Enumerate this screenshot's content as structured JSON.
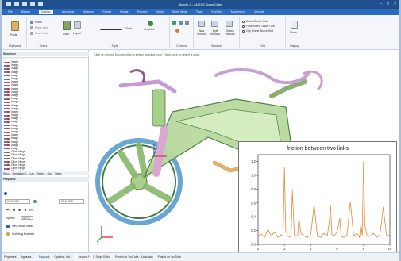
{
  "app": {
    "title": "Bicycle-2 - ANSYS SpaceClaim"
  },
  "menu": {
    "tabs": [
      "File",
      "Design",
      "Display",
      "Assembly",
      "Measure",
      "Facets",
      "Repair",
      "Prepare",
      "Detail",
      "Sheet Metal",
      "Tools",
      "KeyShot",
      "Momentum",
      "Uenzzle"
    ],
    "active_tab": "Display"
  },
  "ribbon": {
    "clipboard": {
      "label": "Clipboard",
      "paste": "Paste"
    },
    "orient": {
      "label": "Orient",
      "home": "Home",
      "plane_view": "Plane View",
      "snap_view": "Snap View"
    },
    "style": {
      "label": "Style",
      "color": "Color",
      "layout": "Layout",
      "thick": "Thick",
      "graphics": "Graphics"
    },
    "camera": {
      "label": "Camera"
    },
    "window": {
      "label": "Window",
      "new_window": "New Window",
      "split_window": "Split Window",
      "switch_window": "Switch Window"
    },
    "grid": {
      "label": "Grid",
      "opt1": "Show Sketch Grid",
      "opt2": "Fade Scene Under Grid",
      "opt3": "Clip Scene Above Grid"
    },
    "display": {
      "label": "Display",
      "show": "Show"
    }
  },
  "structure": {
    "header": "Structure",
    "items": [
      "Image",
      "Image",
      "Image",
      "Image",
      "Image",
      "Image",
      "Image",
      "Image",
      "Image",
      "Image",
      "Image",
      "Image",
      "Image",
      "Image",
      "Image",
      "Image",
      "Image",
      "Image",
      "Image",
      "Image",
      "Image",
      "Image",
      "Image",
      "Image",
      "Image",
      "Image",
      "Image",
      "Other Hinge",
      "Other Hinge",
      "Other Hinge",
      "Other Hinge",
      "Other Hinge",
      "Other Hinge",
      "Other Hinge"
    ],
    "tabs": "Struc… Simulation  S… Lay… Select… Gro… Views"
  },
  "playback": {
    "header": "Playback",
    "time_start": "00:00.000",
    "time_end": "00:40.000",
    "speed_label": "Speed:",
    "speed_value": "100 %",
    "new_initial_state": "New Initial State",
    "scripting": "Scripting Enabled"
  },
  "viewport": {
    "hint": "Click an object. Double-click to select an edge loop. Triple-click to select a solid."
  },
  "status": {
    "items": [
      "Properties",
      "Appeara…",
      "Playback",
      "Options - Sel…",
      "Bicycle-2*",
      "Script Editor",
      "Posted on YouTube - Koalcrash",
      "Posted on YouTube"
    ]
  },
  "chart_data": {
    "type": "line",
    "title": "friction between two links",
    "xlabel": "",
    "ylabel": "",
    "xlim": [
      0,
      10
    ],
    "ylim": [
      0,
      1.3
    ],
    "xticks": [
      0,
      2,
      4,
      6,
      8,
      10
    ],
    "yticks": [
      0.0,
      0.2,
      0.4,
      0.6,
      0.8,
      1.0,
      1.2
    ],
    "grid": false,
    "series": [
      {
        "name": "",
        "color": "#e08a3c",
        "x": [
          0.0,
          0.25,
          0.5,
          0.75,
          1.0,
          1.25,
          1.5,
          1.75,
          1.9,
          2.0,
          2.1,
          2.25,
          2.5,
          2.6,
          2.75,
          3.0,
          3.1,
          3.25,
          3.5,
          3.75,
          4.0,
          4.25,
          4.5,
          4.75,
          5.0,
          5.25,
          5.4,
          5.5,
          5.6,
          5.75,
          6.0,
          6.2,
          6.3,
          6.5,
          6.75,
          7.0,
          7.25,
          7.5,
          7.7,
          7.8,
          7.9,
          8.0,
          8.1,
          8.25,
          8.5,
          8.75,
          9.0,
          9.25,
          9.5,
          9.75,
          10.0
        ],
        "y": [
          0.12,
          0.15,
          0.1,
          0.22,
          0.12,
          0.18,
          0.1,
          0.14,
          0.12,
          1.12,
          0.2,
          0.12,
          0.1,
          0.78,
          0.14,
          0.12,
          0.38,
          0.16,
          0.12,
          0.1,
          0.14,
          0.58,
          0.12,
          0.1,
          0.16,
          0.12,
          0.32,
          0.56,
          0.14,
          0.12,
          0.18,
          0.38,
          0.12,
          0.1,
          0.14,
          0.62,
          0.12,
          0.16,
          0.1,
          0.3,
          0.12,
          1.2,
          0.28,
          0.14,
          0.12,
          0.16,
          0.1,
          0.14,
          0.54,
          0.12,
          0.14
        ]
      }
    ]
  }
}
